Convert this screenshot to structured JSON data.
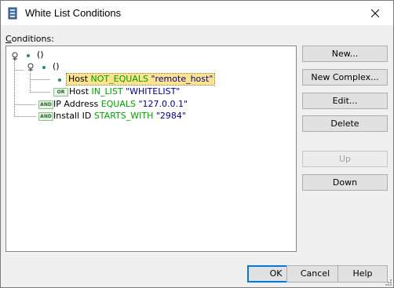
{
  "window": {
    "title": "White List Conditions"
  },
  "conditions_label": "Conditions:",
  "tree": {
    "root_label": "()",
    "group_label": "()",
    "items": [
      {
        "badge": "",
        "field": "Host",
        "op": "NOT_EQUALS",
        "value": "\"remote_host\"",
        "selected": true
      },
      {
        "badge": "OR",
        "field": "Host",
        "op": "IN_LIST",
        "value": "\"WHITELIST\""
      },
      {
        "badge": "AND",
        "field": "IP Address",
        "op": "EQUALS",
        "value": "\"127.0.0.1\""
      },
      {
        "badge": "AND",
        "field": "Install ID",
        "op": "STARTS_WITH",
        "value": "\"2984\""
      }
    ]
  },
  "side_buttons": {
    "new": "New...",
    "new_complex": "New Complex...",
    "edit": "Edit...",
    "delete": "Delete",
    "up": "Up",
    "down": "Down"
  },
  "bottom_buttons": {
    "ok": "OK",
    "cancel": "Cancel",
    "help": "Help"
  },
  "colors": {
    "keyword": "#00a000",
    "string": "#00008b",
    "selection": "#ffe38e"
  }
}
